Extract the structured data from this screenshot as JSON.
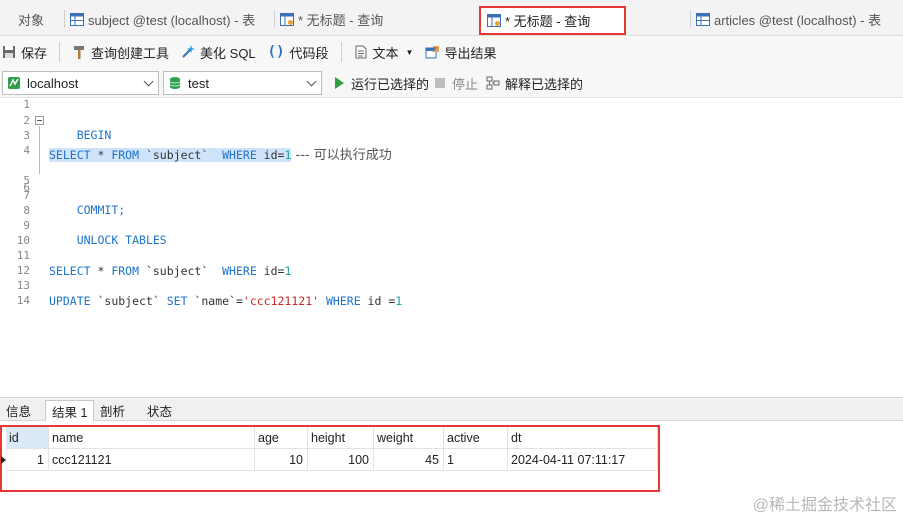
{
  "tabs": [
    {
      "label": "对象"
    },
    {
      "label": "subject @test (localhost) - 表"
    },
    {
      "label": "* 无标题 - 查询"
    },
    {
      "label": "* 无标题 - 查询"
    },
    {
      "label": "articles @test (localhost) - 表"
    }
  ],
  "toolbar": {
    "save": "保存",
    "query_builder": "查询创建工具",
    "beautify": "美化 SQL",
    "code_snippet": "代码段",
    "text": "文本",
    "export": "导出结果"
  },
  "toolbar2": {
    "connection": "localhost",
    "database": "test",
    "run_selected": "运行已选择的",
    "stop": "停止",
    "explain_selected": "解释已选择的"
  },
  "editor": {
    "line_numbers": [
      "1",
      "2",
      "3",
      "4",
      "5",
      "6",
      "7",
      "8",
      "9",
      "10",
      "11",
      "12",
      "13",
      "14"
    ],
    "line2": "BEGIN",
    "line4_kw1": "SELECT",
    "line4_a": " * ",
    "line4_kw2": "FROM",
    "line4_b": " `subject`  ",
    "line4_kw3": "WHERE",
    "line4_c": " id=",
    "line4_num": "1",
    "line4_comment": " --- 可以执行成功",
    "line7": "COMMIT;",
    "line9": "UNLOCK TABLES",
    "line12_kw1": "SELECT",
    "line12_a": " * ",
    "line12_kw2": "FROM",
    "line12_b": " `subject`  ",
    "line12_kw3": "WHERE",
    "line12_c": " id=",
    "line12_num": "1",
    "line14_kw1": "UPDATE",
    "line14_a": " `subject` ",
    "line14_kw2": "SET",
    "line14_b": " `name`=",
    "line14_str": "'ccc121121'",
    "line14_c": " ",
    "line14_kw3": "WHERE",
    "line14_d": " id =",
    "line14_num": "1"
  },
  "bottom_tabs": [
    {
      "label": "信息"
    },
    {
      "label": "结果 1"
    },
    {
      "label": "剖析"
    },
    {
      "label": "状态"
    }
  ],
  "result": {
    "columns": [
      "id",
      "name",
      "age",
      "height",
      "weight",
      "active",
      "dt"
    ],
    "rows": [
      [
        "1",
        "ccc121121",
        "10",
        "100",
        "45",
        "1",
        "2024-04-11 07:11:17"
      ]
    ]
  },
  "watermark": "@稀土掘金技术社区",
  "colors": {
    "accent_red": "#e53935",
    "keyword_blue": "#1e73c9",
    "string_red": "#c62828",
    "number_teal": "#1aa39a"
  }
}
